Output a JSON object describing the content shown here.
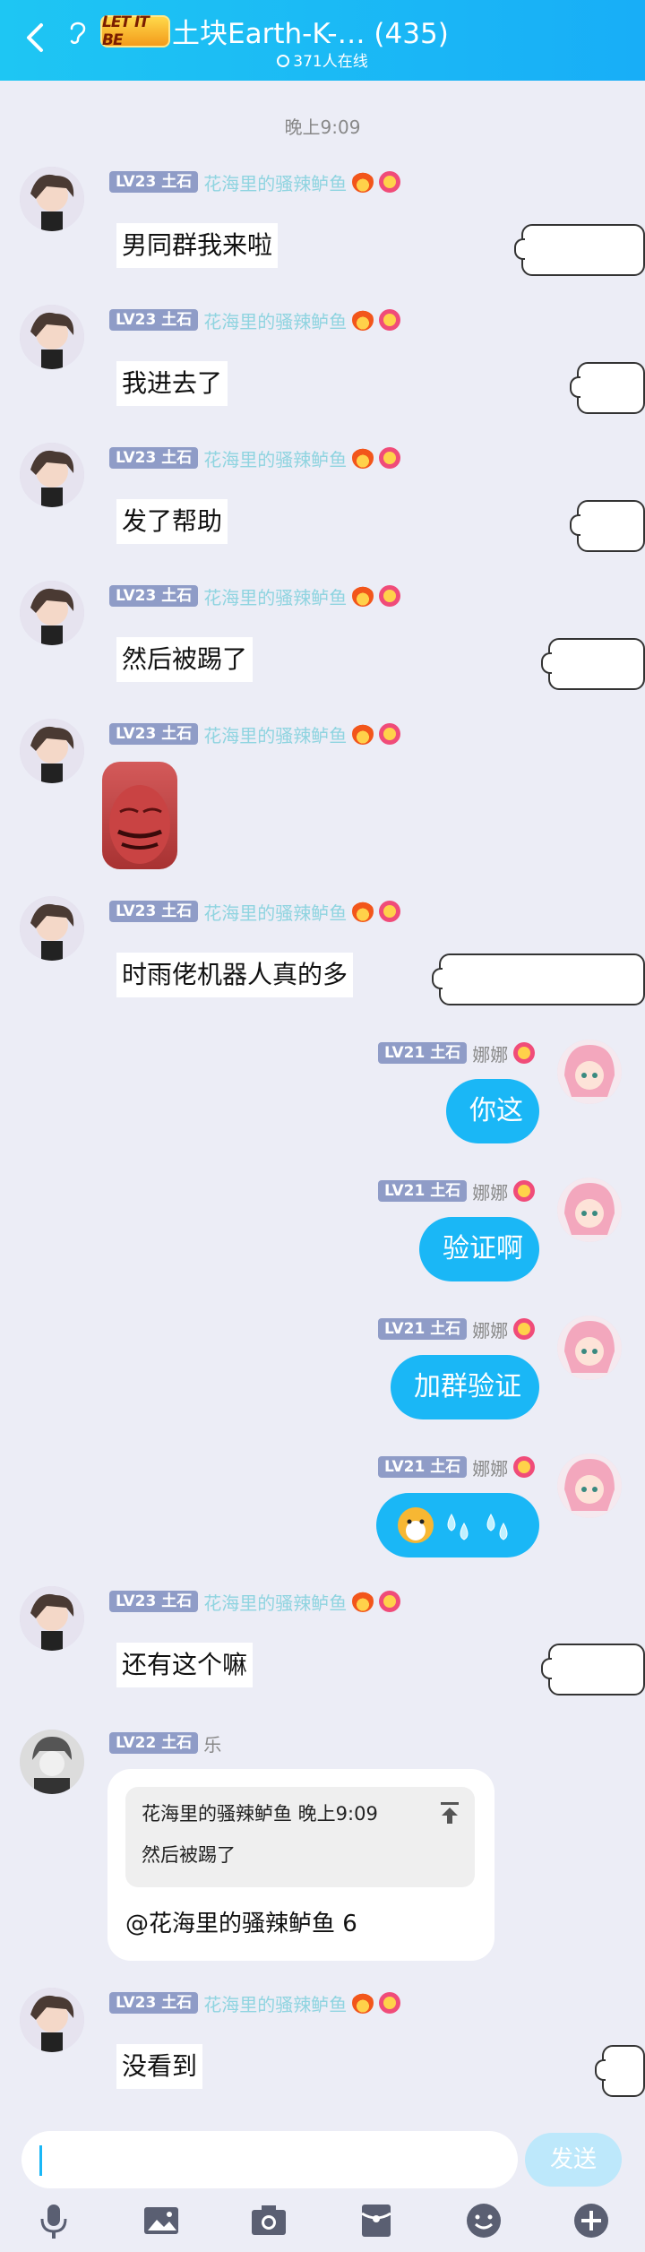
{
  "header": {
    "badge": "LET IT BE",
    "title": "土块Earth-K-… (435)",
    "online": "371人在线"
  },
  "timestamp": "晚上9:09",
  "users": {
    "u1": {
      "level": "LV23",
      "tag": "土石",
      "name": "花海里的骚辣鲈鱼"
    },
    "u2": {
      "level": "LV21",
      "tag": "土石",
      "name": "娜娜"
    },
    "u3": {
      "level": "LV22",
      "tag": "土石",
      "name": "乐"
    }
  },
  "messages": {
    "m1": "男同群我来啦",
    "m2": "我进去了",
    "m3": "发了帮助",
    "m4": "然后被踢了",
    "m6": "时雨佬机器人真的多",
    "m7": "你这",
    "m8": "验证啊",
    "m9": "加群验证",
    "m11": "还有这个嘛",
    "m13": "没看到"
  },
  "reply": {
    "quote_header": "花海里的骚辣鲈鱼 晚上9:09",
    "quote_text": "然后被踢了",
    "text": "@花海里的骚辣鲈鱼 6"
  },
  "input": {
    "value": "",
    "send_label": "发送"
  },
  "toolbar": [
    "mic-icon",
    "image-icon",
    "camera-icon",
    "red-packet-icon",
    "emoji-icon",
    "plus-icon"
  ],
  "colors": {
    "header": "#18aef7",
    "bubble_self": "#1ab7f6",
    "background": "#ecedf6",
    "level_badge": "#8f9cc7"
  }
}
